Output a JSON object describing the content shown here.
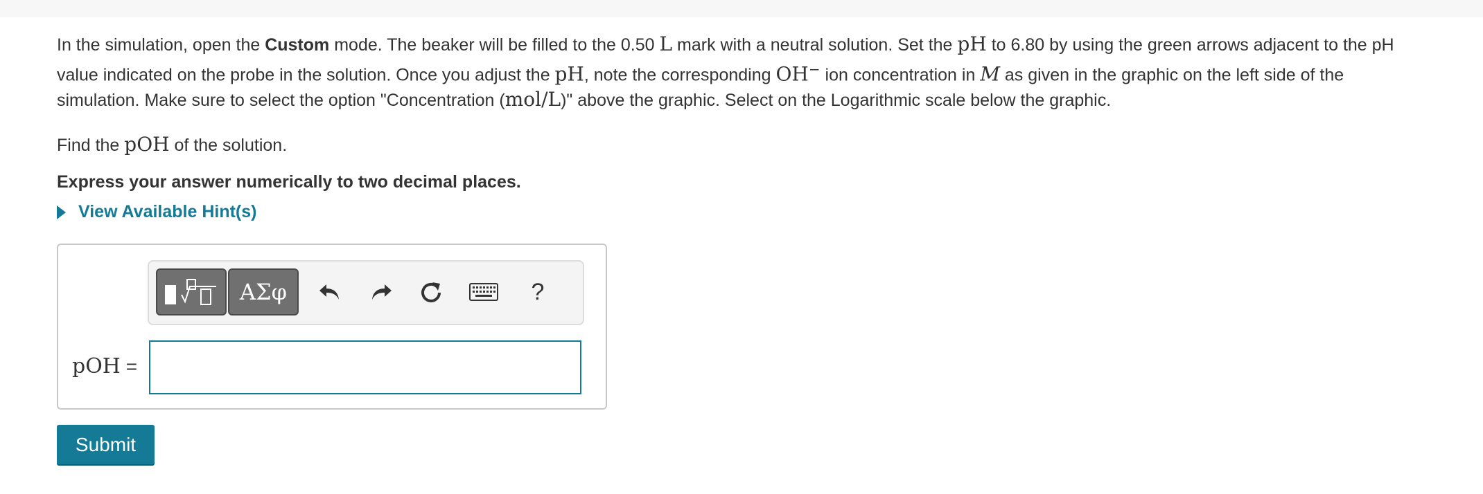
{
  "problem": {
    "p1_a": "In the simulation, open the ",
    "p1_custom": "Custom",
    "p1_b": " mode. The beaker will be filled to the 0.50 ",
    "p1_L": "L",
    "p1_c": " mark with  a neutral solution. Set the ",
    "p1_pH": "pH",
    "p1_d": " to 6.80 by using the green arrows adjacent to the pH",
    "p2_a": "value indicated on the probe in the solution. Once you adjust the ",
    "p2_pH": "pH",
    "p2_b": ", note the corresponding ",
    "p2_OH": "OH",
    "p2_sup": "−",
    "p2_c": " ion concentration in ",
    "p2_M": "M",
    "p2_d": " as given in the graphic on the left side of the",
    "p3_a": "simulation. Make sure to select the option \"Concentration (",
    "p3_unit": "mol/L",
    "p3_b": ")\" above the graphic. Select on the Logarithmic scale below the graphic.",
    "prompt_a": "Find the ",
    "prompt_pOH": "pOH",
    "prompt_b": " of the solution.",
    "instruction": "Express your answer numerically to two decimal places."
  },
  "hint": {
    "label": "View Available Hint(s)"
  },
  "toolbar": {
    "templates_label": "templates",
    "greek_label": "ΑΣφ",
    "help_label": "?"
  },
  "answer": {
    "label_var": "pOH",
    "label_eq": " =",
    "value": "",
    "placeholder": ""
  },
  "submit": {
    "label": "Submit"
  },
  "colors": {
    "accent": "#147a96",
    "toolbar_button": "#707070"
  }
}
